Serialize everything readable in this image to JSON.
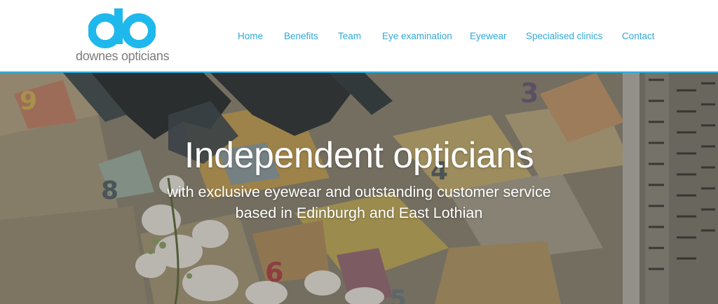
{
  "brand": {
    "logo_mark": "do",
    "name": "downes opticians",
    "accent_color": "#1fb8ec",
    "text_color": "#7d7d7d"
  },
  "nav": {
    "items": [
      {
        "label": "Home"
      },
      {
        "label": "Benefits"
      },
      {
        "label": "Team"
      },
      {
        "label": "Eye examination"
      },
      {
        "label": "Eyewear"
      },
      {
        "label": "Specialised clinics"
      },
      {
        "label": "Contact"
      }
    ],
    "color": "#32a8d8"
  },
  "hero": {
    "title": "Independent opticians",
    "subtitle_line1": "with exclusive eyewear and outstanding customer service",
    "subtitle_line2": "based in Edinburgh and East Lothian",
    "mural_numbers": [
      "9",
      "3",
      "8",
      "4",
      "6",
      "5"
    ]
  }
}
